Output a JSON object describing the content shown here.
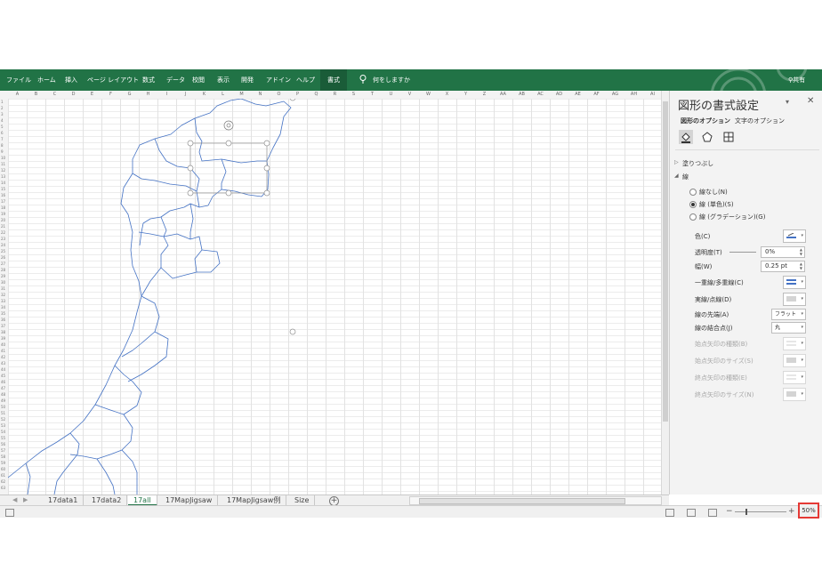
{
  "ribbon": {
    "tabs": [
      "ファイル",
      "ホーム",
      "挿入",
      "ページ レイアウト",
      "数式",
      "データ",
      "校閲",
      "表示",
      "開発",
      "アドイン",
      "ヘルプ"
    ],
    "active_tab": "書式",
    "tell_me": "何をしますか",
    "share": "共有"
  },
  "sheet": {
    "columns": [
      "A",
      "B",
      "C",
      "D",
      "E",
      "F",
      "G",
      "H",
      "I",
      "J",
      "K",
      "L",
      "M",
      "N",
      "O",
      "P",
      "Q",
      "R",
      "S",
      "T",
      "U",
      "V",
      "W",
      "X",
      "Y",
      "Z",
      "AA",
      "AB",
      "AC",
      "AD",
      "AE",
      "AF",
      "AG",
      "AH",
      "AI"
    ],
    "row_count": 63
  },
  "sheet_tabs": {
    "tabs": [
      "17data1",
      "17data2",
      "17all",
      "17MapJigsaw",
      "17MapJigsaw例",
      "Size"
    ],
    "active": "17all"
  },
  "format_pane": {
    "title": "図形の書式設定",
    "tab_shape": "図形のオプション",
    "tab_text": "文字のオプション",
    "section_fill": "塗りつぶし",
    "section_line": "線",
    "radio_none": "線なし(N)",
    "radio_solid": "線 (単色)(S)",
    "radio_gradient": "線 (グラデーション)(G)",
    "label_color": "色(C)",
    "label_transparency": "透明度(T)",
    "value_transparency": "0%",
    "label_width": "幅(W)",
    "value_width": "0.25 pt",
    "label_compound": "一重線/多重線(C)",
    "label_dash": "実線/点線(D)",
    "label_cap": "線の先端(A)",
    "value_cap": "フラット",
    "label_join": "線の結合点(J)",
    "value_join": "丸",
    "label_begin_arrow_type": "始点矢印の種類(B)",
    "label_begin_arrow_size": "始点矢印のサイズ(S)",
    "label_end_arrow_type": "終点矢印の種類(E)",
    "label_end_arrow_size": "終点矢印のサイズ(N)"
  },
  "status": {
    "zoom": "50%"
  },
  "colors": {
    "excel_green": "#217346",
    "map_line": "#4472c4",
    "highlight_box": "#e53935"
  }
}
